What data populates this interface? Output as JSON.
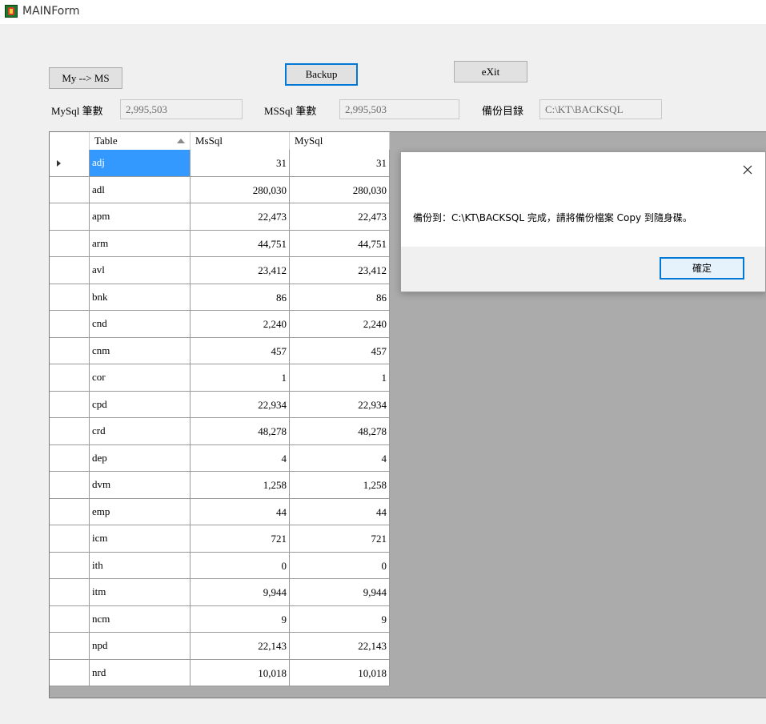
{
  "window": {
    "title": "MAINForm"
  },
  "toolbar": {
    "my_to_ms_label": "My --> MS",
    "backup_label": "Backup",
    "exit_label": "eXit"
  },
  "fields": {
    "mysql_count_label": "MySql 筆數",
    "mysql_count_value": "2,995,503",
    "mssql_count_label": "MSSql 筆數",
    "mssql_count_value": "2,995,503",
    "backup_dir_label": "備份目錄",
    "backup_dir_value": "C:\\KT\\BACKSQL"
  },
  "grid": {
    "columns": [
      "Table",
      "MsSql",
      "MySql"
    ],
    "sort_column": "Table",
    "sort_direction": "ascending",
    "selected_row": 0,
    "rows": [
      {
        "table": "adj",
        "mssql": "31",
        "mysql": "31"
      },
      {
        "table": "adl",
        "mssql": "280,030",
        "mysql": "280,030"
      },
      {
        "table": "apm",
        "mssql": "22,473",
        "mysql": "22,473"
      },
      {
        "table": "arm",
        "mssql": "44,751",
        "mysql": "44,751"
      },
      {
        "table": "avl",
        "mssql": "23,412",
        "mysql": "23,412"
      },
      {
        "table": "bnk",
        "mssql": "86",
        "mysql": "86"
      },
      {
        "table": "cnd",
        "mssql": "2,240",
        "mysql": "2,240"
      },
      {
        "table": "cnm",
        "mssql": "457",
        "mysql": "457"
      },
      {
        "table": "cor",
        "mssql": "1",
        "mysql": "1"
      },
      {
        "table": "cpd",
        "mssql": "22,934",
        "mysql": "22,934"
      },
      {
        "table": "crd",
        "mssql": "48,278",
        "mysql": "48,278"
      },
      {
        "table": "dep",
        "mssql": "4",
        "mysql": "4"
      },
      {
        "table": "dvm",
        "mssql": "1,258",
        "mysql": "1,258"
      },
      {
        "table": "emp",
        "mssql": "44",
        "mysql": "44"
      },
      {
        "table": "icm",
        "mssql": "721",
        "mysql": "721"
      },
      {
        "table": "ith",
        "mssql": "0",
        "mysql": "0"
      },
      {
        "table": "itm",
        "mssql": "9,944",
        "mysql": "9,944"
      },
      {
        "table": "ncm",
        "mssql": "9",
        "mysql": "9"
      },
      {
        "table": "npd",
        "mssql": "22,143",
        "mysql": "22,143"
      },
      {
        "table": "nrd",
        "mssql": "10,018",
        "mysql": "10,018"
      }
    ]
  },
  "dialog": {
    "message": "備份到：C:\\KT\\BACKSQL 完成，請將備份檔案 Copy 到隨身碟。",
    "ok_label": "確定"
  }
}
